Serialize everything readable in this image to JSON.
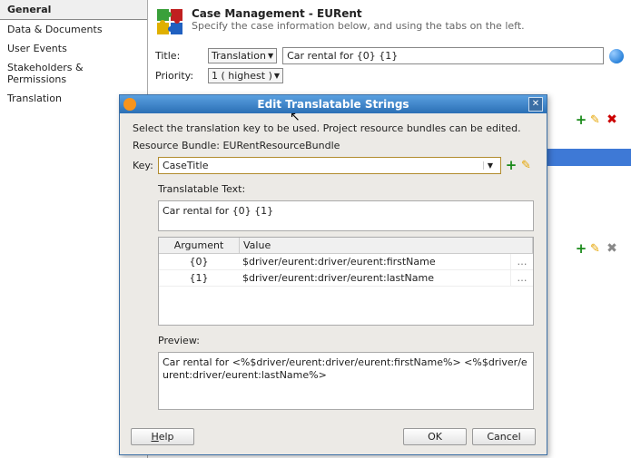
{
  "sidebar": {
    "items": [
      "General",
      "Data & Documents",
      "User Events",
      "Stakeholders & Permissions",
      "Translation"
    ],
    "active": 0
  },
  "header": {
    "title": "Case Management - EURent",
    "subtitle": "Specify the case information below, and using the tabs on the left."
  },
  "form": {
    "title_label": "Title:",
    "title_select": "Translation",
    "title_value": "Car rental for {0} {1}",
    "priority_label": "Priority:",
    "priority_select": "1 ( highest )"
  },
  "dialog": {
    "title": "Edit Translatable Strings",
    "intro": "Select the translation key to be used. Project resource bundles can be edited.",
    "bundle_label": "Resource Bundle:",
    "bundle_value": "EURentResourceBundle",
    "key_label": "Key:",
    "key_value": "CaseTitle",
    "translatable_label": "Translatable Text:",
    "translatable_value": "Car rental for {0} {1}",
    "args_header_arg": "Argument",
    "args_header_val": "Value",
    "args": [
      {
        "arg": "{0}",
        "val": "$driver/eurent:driver/eurent:firstName"
      },
      {
        "arg": "{1}",
        "val": "$driver/eurent:driver/eurent:lastName"
      }
    ],
    "preview_label": "Preview:",
    "preview_value": "Car rental for <%$driver/eurent:driver/eurent:firstName%> <%$driver/eurent:driver/eurent:lastName%>",
    "help": "Help",
    "ok": "OK",
    "cancel": "Cancel"
  }
}
